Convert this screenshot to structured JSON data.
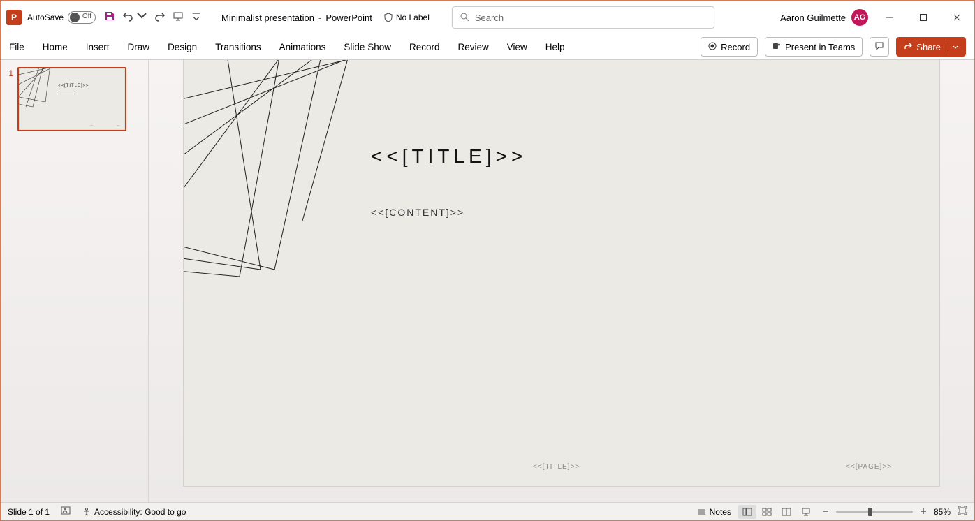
{
  "titlebar": {
    "autosave_label": "AutoSave",
    "autosave_state": "Off",
    "doc_name": "Minimalist presentation",
    "app_name": "PowerPoint",
    "no_label": "No Label",
    "search_placeholder": "Search",
    "user_name": "Aaron Guilmette",
    "user_initials": "AG"
  },
  "ribbon": {
    "tabs": [
      "File",
      "Home",
      "Insert",
      "Draw",
      "Design",
      "Transitions",
      "Animations",
      "Slide Show",
      "Record",
      "Review",
      "View",
      "Help"
    ],
    "record_btn": "Record",
    "present_btn": "Present in Teams",
    "share_btn": "Share"
  },
  "thumbs": {
    "items": [
      {
        "num": "1"
      }
    ]
  },
  "slide": {
    "title": "<<[TITLE]>>",
    "content": "<<[CONTENT]>>",
    "footer_title": "<<[TITLE]>>",
    "footer_page": "<<[PAGE]>>"
  },
  "statusbar": {
    "slide_info": "Slide 1 of 1",
    "accessibility": "Accessibility: Good to go",
    "notes_label": "Notes",
    "zoom_pct": "85%"
  }
}
